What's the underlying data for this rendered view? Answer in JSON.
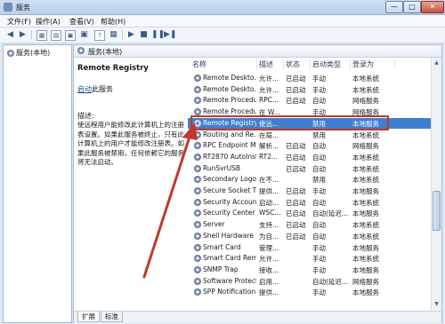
{
  "window": {
    "title": "服务",
    "min": "—",
    "max": "□",
    "close": "✕"
  },
  "menu": [
    {
      "label": "文件(F)"
    },
    {
      "label": "操作(A)"
    },
    {
      "label": "查看(V)"
    },
    {
      "label": "帮助(H)"
    }
  ],
  "toolbar": {
    "buttons": [
      "◀",
      "▶",
      "▦",
      "▤",
      "▣",
      "?",
      "▦",
      "▶",
      "■",
      "❚❚",
      "▶❚"
    ]
  },
  "left_pane": {
    "tree_label": "服务(本地)"
  },
  "right_pane": {
    "header": "服务(本地)",
    "detail": {
      "title": "Remote Registry",
      "link_text": "启动",
      "link_suffix": "此服务",
      "desc_label": "描述:",
      "description": "使远程用户能修改此计算机上的注册表设置。如果此服务被终止，只有此计算机上的用户才能修改注册表。如果此服务被禁用，任何依赖它的服务将无法启动。"
    },
    "columns": [
      "名称",
      "描述",
      "状态",
      "启动类型",
      "登录为"
    ],
    "rows": [
      {
        "name": "Remote Deskto...",
        "desc": "允许...",
        "status": "已启动",
        "startup": "手动",
        "logon": "本地系统"
      },
      {
        "name": "Remote Deskto...",
        "desc": "允许...",
        "status": "已启动",
        "startup": "手动",
        "logon": "本地系统"
      },
      {
        "name": "Remote Procedu...",
        "desc": "RPC...",
        "status": "已启动",
        "startup": "自动",
        "logon": "网络服务"
      },
      {
        "name": "Remote Procedu...",
        "desc": "在 W...",
        "status": "",
        "startup": "手动",
        "logon": "网络服务"
      },
      {
        "name": "Remote Registry",
        "desc": "使远...",
        "status": "",
        "startup": "禁用",
        "logon": "本地服务",
        "selected": true
      },
      {
        "name": "Routing and Re...",
        "desc": "在局...",
        "status": "",
        "startup": "禁用",
        "logon": "本地系统"
      },
      {
        "name": "RPC Endpoint M...",
        "desc": "解析...",
        "status": "已启动",
        "startup": "自动",
        "logon": "网络服务"
      },
      {
        "name": "RT2870 AutoInst...",
        "desc": "RT2...",
        "status": "已启动",
        "startup": "自动",
        "logon": "本地系统"
      },
      {
        "name": "RunSvrUSB",
        "desc": "",
        "status": "已启动",
        "startup": "自动",
        "logon": "本地系统"
      },
      {
        "name": "Secondary Logon",
        "desc": "在不...",
        "status": "",
        "startup": "禁用",
        "logon": "本地系统"
      },
      {
        "name": "Secure Socket T...",
        "desc": "提供...",
        "status": "已启动",
        "startup": "手动",
        "logon": "本地服务"
      },
      {
        "name": "Security Account...",
        "desc": "启动...",
        "status": "已启动",
        "startup": "自动",
        "logon": "本地系统"
      },
      {
        "name": "Security Center",
        "desc": "WSC...",
        "status": "已启动",
        "startup": "自动(延迟...",
        "logon": "本地服务"
      },
      {
        "name": "Server",
        "desc": "支持...",
        "status": "已启动",
        "startup": "自动",
        "logon": "本地系统"
      },
      {
        "name": "Shell Hardware ...",
        "desc": "为自...",
        "status": "已启动",
        "startup": "自动",
        "logon": "本地系统"
      },
      {
        "name": "Smart Card",
        "desc": "管理...",
        "status": "",
        "startup": "手动",
        "logon": "本地服务"
      },
      {
        "name": "Smart Card Rem...",
        "desc": "允许...",
        "status": "",
        "startup": "手动",
        "logon": "本地系统"
      },
      {
        "name": "SNMP Trap",
        "desc": "接收...",
        "status": "",
        "startup": "手动",
        "logon": "本地服务"
      },
      {
        "name": "Software Protect...",
        "desc": "启用...",
        "status": "",
        "startup": "自动(延迟...",
        "logon": "网络服务"
      },
      {
        "name": "SPP Notification ...",
        "desc": "提供...",
        "status": "",
        "startup": "手动",
        "logon": "本地服务"
      }
    ],
    "tabs": [
      "扩展",
      "标准"
    ]
  },
  "colors": {
    "selection": "#3f7fd1",
    "highlight": "#c0392b"
  }
}
